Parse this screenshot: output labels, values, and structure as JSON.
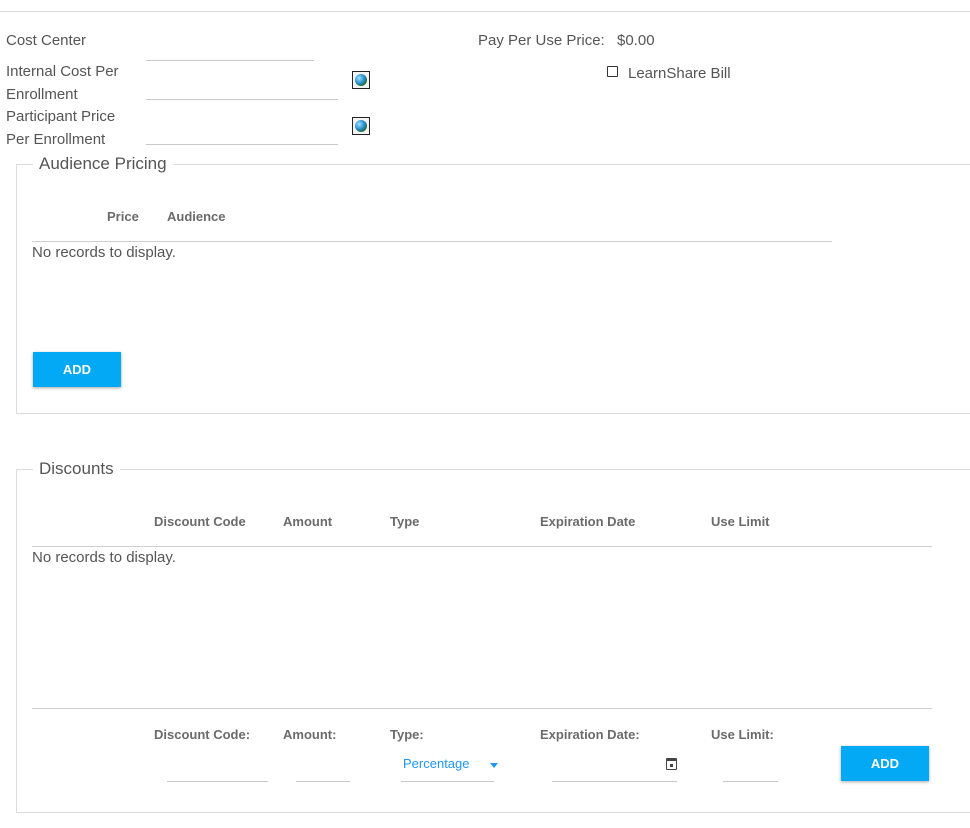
{
  "form": {
    "cost_center_label": "Cost Center",
    "cost_center_value": "",
    "internal_cost_label_1": "Internal Cost Per",
    "internal_cost_label_2": "Enrollment",
    "internal_cost_value": "",
    "participant_price_label_1": "Participant Price",
    "participant_price_label_2": "Per Enrollment",
    "participant_price_value": "",
    "globe_icon": "globe-icon",
    "pay_per_use_label": "Pay Per Use Price:",
    "pay_per_use_value": "$0.00",
    "learnshare_bill_label": "LearnShare Bill",
    "learnshare_bill_checked": false
  },
  "audience_pricing": {
    "legend": "Audience Pricing",
    "columns": [
      "Price",
      "Audience"
    ],
    "rows": [],
    "empty_text": "No records to display.",
    "add_label": "ADD"
  },
  "discounts": {
    "legend": "Discounts",
    "columns": [
      "Discount Code",
      "Amount",
      "Type",
      "Expiration Date",
      "Use Limit"
    ],
    "rows": [],
    "empty_text": "No records to display.",
    "footer": {
      "discount_code_label": "Discount Code:",
      "amount_label": "Amount:",
      "type_label": "Type:",
      "expiration_label": "Expiration Date:",
      "use_limit_label": "Use Limit:",
      "discount_code_value": "",
      "amount_value": "",
      "type_value": "Percentage",
      "expiration_value": "",
      "use_limit_value": "",
      "add_label": "ADD"
    }
  },
  "colors": {
    "accent": "#03a9f4",
    "select_text": "#2196f3"
  }
}
